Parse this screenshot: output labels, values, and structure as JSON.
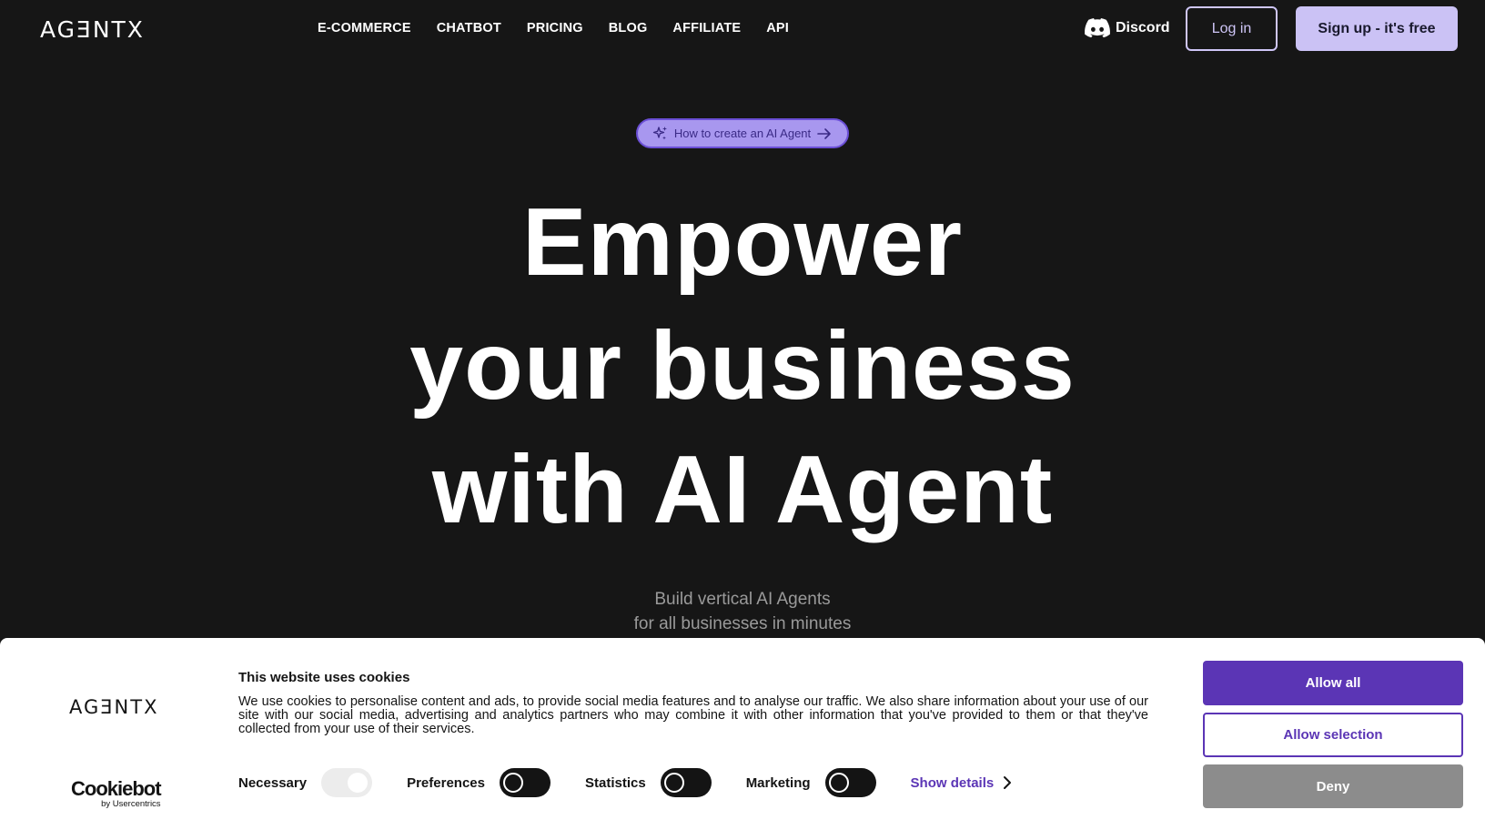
{
  "header": {
    "logo": "AGƎNTX",
    "nav": [
      "E-COMMERCE",
      "CHATBOT",
      "PRICING",
      "BLOG",
      "AFFILIATE",
      "API"
    ],
    "discord_label": "Discord",
    "login_label": "Log in",
    "signup_label": "Sign up - it's free"
  },
  "hero": {
    "pill_label": "How to create an AI Agent",
    "title_line1": "Empower",
    "title_line2": "your business",
    "title_line3": "with AI Agent",
    "subtitle_line1": "Build vertical AI Agents",
    "subtitle_line2": "for all businesses in minutes"
  },
  "cookie_banner": {
    "logo": "AGƎNTX",
    "cookiebot_name": "Cookiebot",
    "cookiebot_by": "by Usercentrics",
    "title": "This website uses cookies",
    "text": "We use cookies to personalise content and ads, to provide social media features and to analyse our traffic. We also share information about your use of our site with our social media, advertising and analytics partners who may combine it with other information that you've provided to them or that they've collected from your use of their services.",
    "categories": [
      {
        "label": "Necessary",
        "state": "on-disabled"
      },
      {
        "label": "Preferences",
        "state": "off"
      },
      {
        "label": "Statistics",
        "state": "off"
      },
      {
        "label": "Marketing",
        "state": "off"
      }
    ],
    "show_details_label": "Show details",
    "allow_all_label": "Allow all",
    "allow_selection_label": "Allow selection",
    "deny_label": "Deny"
  },
  "colors": {
    "background": "#161616",
    "accent_light": "#cbc2f5",
    "accent_purple": "#5b35b5",
    "pill_bg": "#a897ef"
  }
}
